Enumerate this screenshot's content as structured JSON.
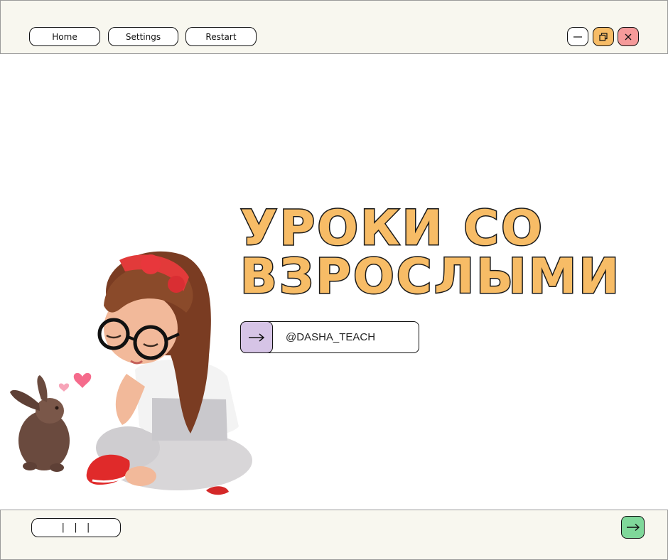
{
  "topbar": {
    "nav": [
      {
        "label": "Home"
      },
      {
        "label": "Settings"
      },
      {
        "label": "Restart"
      }
    ],
    "window_controls": {
      "minimize_icon": "minimize-icon",
      "restore_icon": "restore-icon",
      "close_icon": "close-icon",
      "minimize_color": "#ffffff",
      "restore_color": "#f7bc66",
      "close_color": "#f59a9a"
    }
  },
  "main": {
    "title_line1": "УРОКИ СО",
    "title_line2": "ВЗРОСЛЫМИ",
    "title_color": "#f7bc66",
    "handle": "@DASHA_TEACH",
    "handle_icon": "arrow-right-icon",
    "handle_icon_bg": "#d6c4e6"
  },
  "bottombar": {
    "pager_label": "| | |",
    "next_icon": "arrow-right-icon",
    "next_color": "#7fd89a"
  }
}
